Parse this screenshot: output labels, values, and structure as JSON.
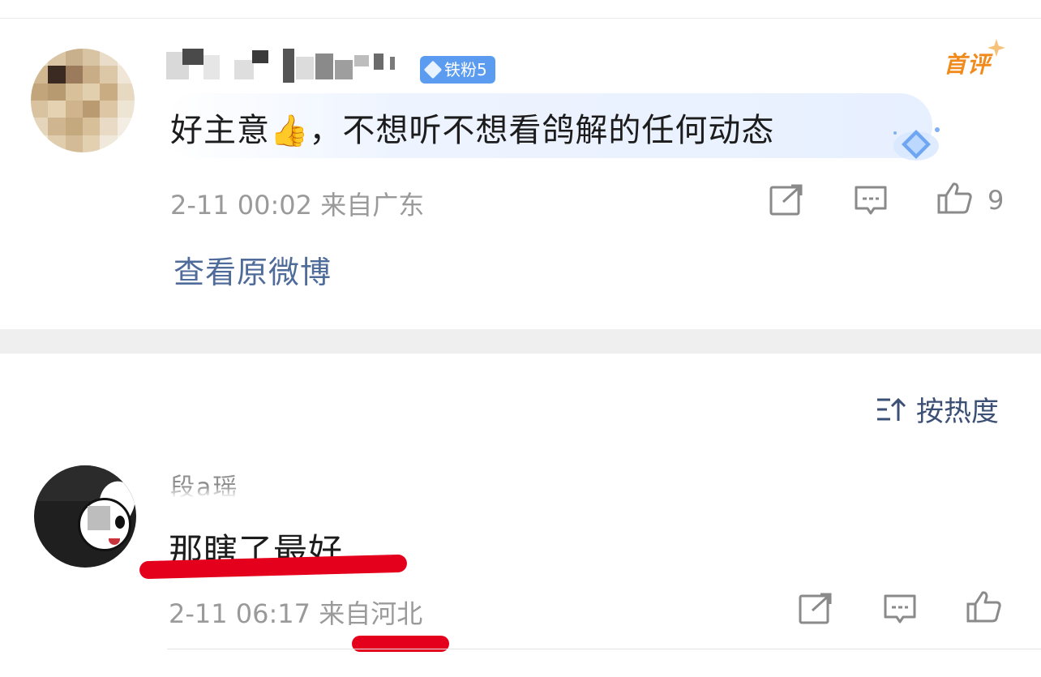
{
  "comment1": {
    "badge_label": "铁粉5",
    "first_label": "首评",
    "emoji": "👍",
    "text_before_emoji": "好主意",
    "text_after_emoji": "，不想听不想看鸽解的任何动态",
    "meta": "2-11 00:02  来自广东",
    "like_count": "9",
    "view_original": "查看原微博"
  },
  "sort": {
    "label": "按热度"
  },
  "comment2": {
    "username": "段a瑶",
    "text": "那瞎了最好",
    "meta": "2-11 06:17  来自河北"
  },
  "colors": {
    "link_blue": "#4e6b9a",
    "badge_blue": "#5b9cf0",
    "first_orange": "#f08a1c",
    "annotation_red": "#e4001d"
  },
  "icons": [
    "forward-icon",
    "comment-icon",
    "like-icon",
    "sort-icon",
    "diamond-icon"
  ]
}
